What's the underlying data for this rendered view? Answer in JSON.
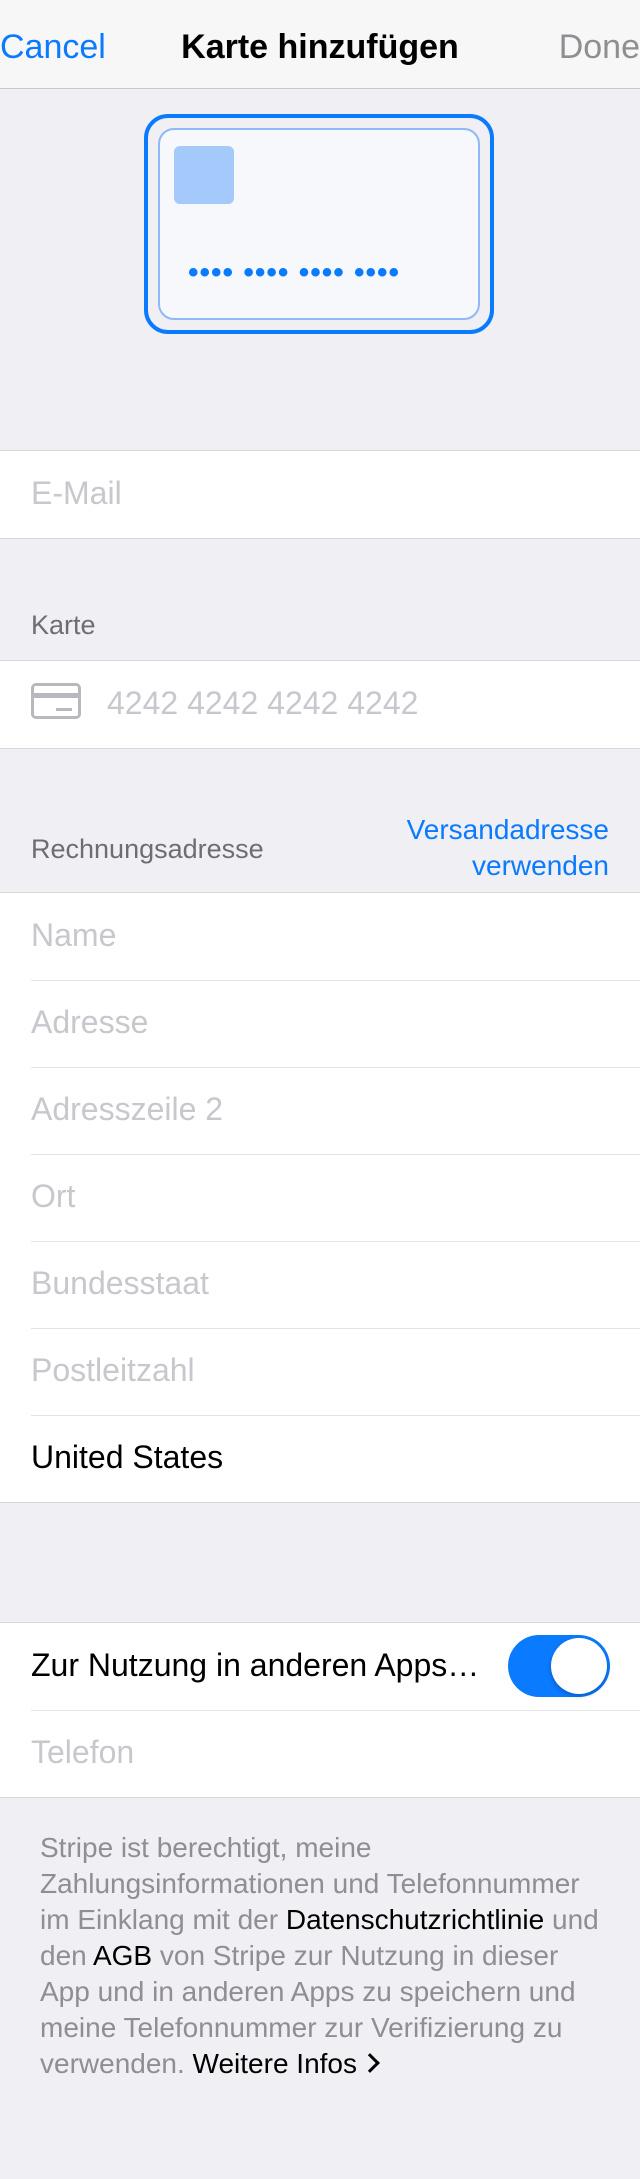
{
  "nav": {
    "cancel": "Cancel",
    "title": "Karte hinzufügen",
    "done": "Done"
  },
  "card_preview": {
    "dots": "•••• •••• •••• ••••"
  },
  "email": {
    "placeholder": "E-Mail"
  },
  "card_section": {
    "header": "Karte",
    "number_placeholder": "4242 4242 4242 4242",
    "icon": "credit-card-icon"
  },
  "billing": {
    "header": "Rechnungsadresse",
    "use_shipping_line1": "Versandadresse",
    "use_shipping_line2": "verwenden",
    "fields": {
      "name": "Name",
      "address": "Adresse",
      "address2": "Adresszeile 2",
      "city": "Ort",
      "state": "Bundesstaat",
      "zip": "Postleitzahl",
      "country": "United States"
    }
  },
  "link": {
    "toggle_label": "Zur Nutzung in anderen Apps…",
    "toggle_on": true,
    "phone_placeholder": "Telefon"
  },
  "footer": {
    "part1": "Stripe ist berechtigt, meine Zahlungsinformationen und Telefonnummer im Einklang mit der",
    "privacy": "Datenschutzrichtlinie",
    "part2": "und den",
    "terms": "AGB",
    "part3": "von Stripe zur Nutzung in dieser App und in anderen Apps zu speichern und meine Telefonnummer zur Verifizierung zu verwenden.",
    "more": "Weitere Infos"
  },
  "colors": {
    "accent": "#0a7aff",
    "background": "#efeff4",
    "placeholder": "#c7c7cd"
  }
}
